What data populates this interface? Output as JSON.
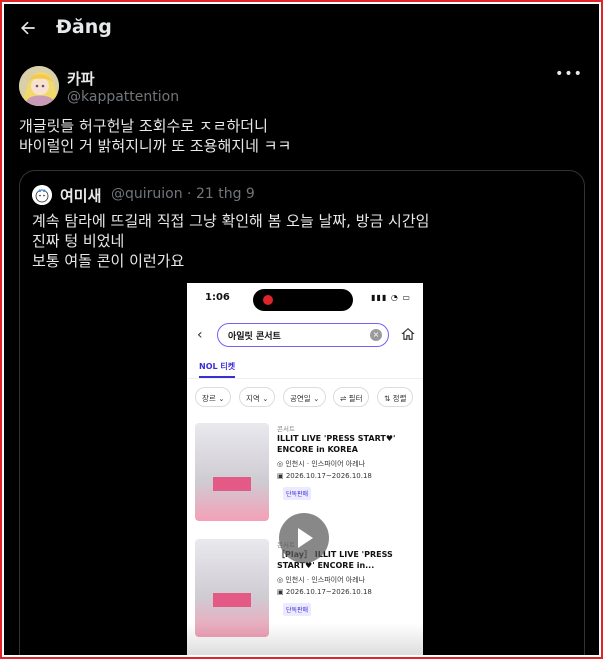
{
  "header": {
    "title": "Đăng"
  },
  "post": {
    "author_name": "카파",
    "author_handle": "@kappattention",
    "text_lines": [
      "개글릿들 허구헌날 조회수로 ㅈㄹ하더니",
      "바이럴인 거 밝혀지니까 또 조용해지네 ㅋㅋ"
    ]
  },
  "quote": {
    "author_name": "여미새",
    "author_meta": "@quiruion · 21 thg 9",
    "text_lines": [
      "계속 탐라에 뜨길래 직접 그냥 확인해 봄 오늘 날짜, 방금 시간임",
      "진짜 텅 비었네",
      "보통 여돌 콘이 이런가요"
    ],
    "media": {
      "status_time": "1:06",
      "search_text": "아일릿 콘서트",
      "tab_label": "NOL 티켓",
      "filters": [
        "장르",
        "지역",
        "공연일",
        "필터",
        "정렬"
      ],
      "results": [
        {
          "category": "콘서트",
          "title": "ILLIT LIVE 'PRESS START♥' ENCORE in KOREA",
          "location": "인천시 · 인스파이어 아레나",
          "date": "2026.10.17~2026.10.18",
          "badge": "단독판매"
        },
        {
          "category": "콘서트",
          "title": "［Play］ ILLIT LIVE 'PRESS START♥' ENCORE in...",
          "location": "인천시 · 인스파이어 아레나",
          "date": "2026.10.17~2026.10.18",
          "badge": "단독판매"
        }
      ]
    }
  },
  "colors": {
    "background": "#000000",
    "text": "#e7e9ea",
    "muted": "#71767b",
    "border": "#2f3336",
    "accent": "#3a2fd6",
    "frame": "#e0242b"
  },
  "icons": [
    "back-arrow-icon",
    "more-icon",
    "play-icon",
    "search-clear-icon",
    "home-icon"
  ]
}
